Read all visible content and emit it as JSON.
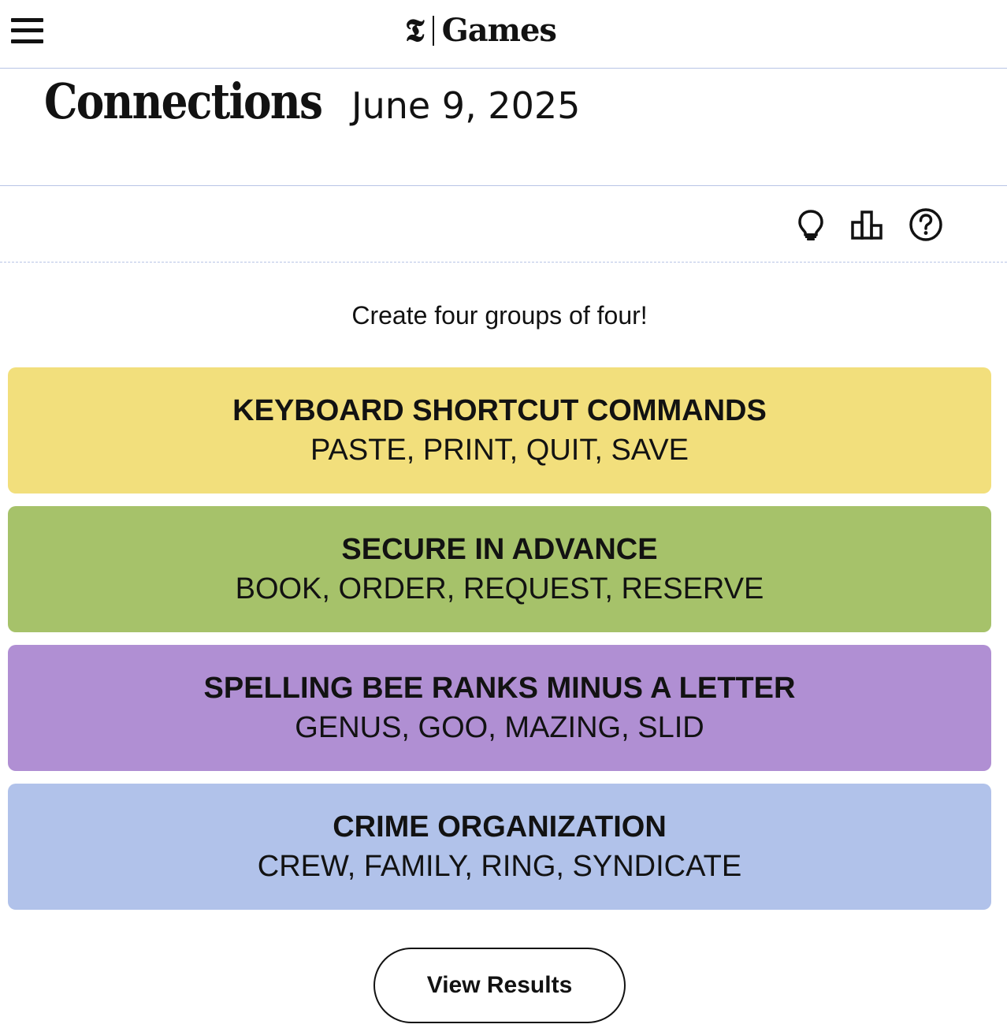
{
  "header": {
    "menu_icon": "hamburger-menu-icon",
    "logo_mark": "𝕿",
    "logo_text": "Games"
  },
  "puzzle": {
    "title": "Connections",
    "date": "June 9, 2025"
  },
  "toolbar": {
    "icons": [
      "lightbulb-icon",
      "leaderboard-icon",
      "help-icon"
    ]
  },
  "instructions": "Create four groups of four!",
  "groups": [
    {
      "title": "KEYBOARD SHORTCUT COMMANDS",
      "words": "PASTE, PRINT, QUIT, SAVE",
      "color": "#f2df7c"
    },
    {
      "title": "SECURE IN ADVANCE",
      "words": "BOOK, ORDER, REQUEST, RESERVE",
      "color": "#a6c26a"
    },
    {
      "title": "SPELLING BEE RANKS MINUS A LETTER",
      "words": "GENUS, GOO, MAZING, SLID",
      "color": "#b08fd3"
    },
    {
      "title": "CRIME ORGANIZATION",
      "words": "CREW, FAMILY, RING, SYNDICATE",
      "color": "#b1c2ea"
    }
  ],
  "view_results_label": "View Results"
}
